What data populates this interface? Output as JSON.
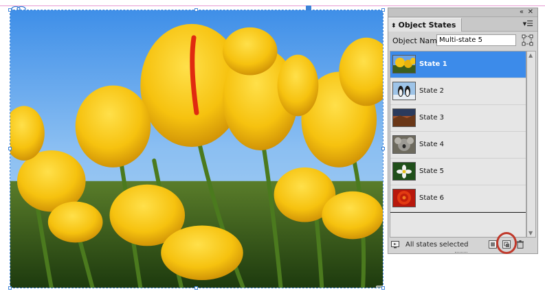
{
  "panel": {
    "title": "Object States",
    "object_name_label": "Object Name:",
    "object_name_value": "Multi-state 5",
    "states": [
      {
        "label": "State 1",
        "selected": true,
        "thumb": "yellow-tulips"
      },
      {
        "label": "State 2",
        "selected": false,
        "thumb": "penguins"
      },
      {
        "label": "State 3",
        "selected": false,
        "thumb": "desert-landscape"
      },
      {
        "label": "State 4",
        "selected": false,
        "thumb": "koala"
      },
      {
        "label": "State 5",
        "selected": false,
        "thumb": "white-flower"
      },
      {
        "label": "State 6",
        "selected": false,
        "thumb": "red-chrysanthemum"
      }
    ],
    "status": "All states selected",
    "icons": {
      "collapse": "double-chevron-icon",
      "close": "close-icon",
      "menu": "panel-menu-icon",
      "convert": "convert-to-buttons-icon",
      "preview": "preview-icon",
      "release": "release-state-icon",
      "new_state": "new-state-icon",
      "delete": "trash-icon"
    }
  },
  "colors": {
    "selection": "#3c8bea",
    "frame": "#3b82d8",
    "highlight": "#c0392b"
  }
}
